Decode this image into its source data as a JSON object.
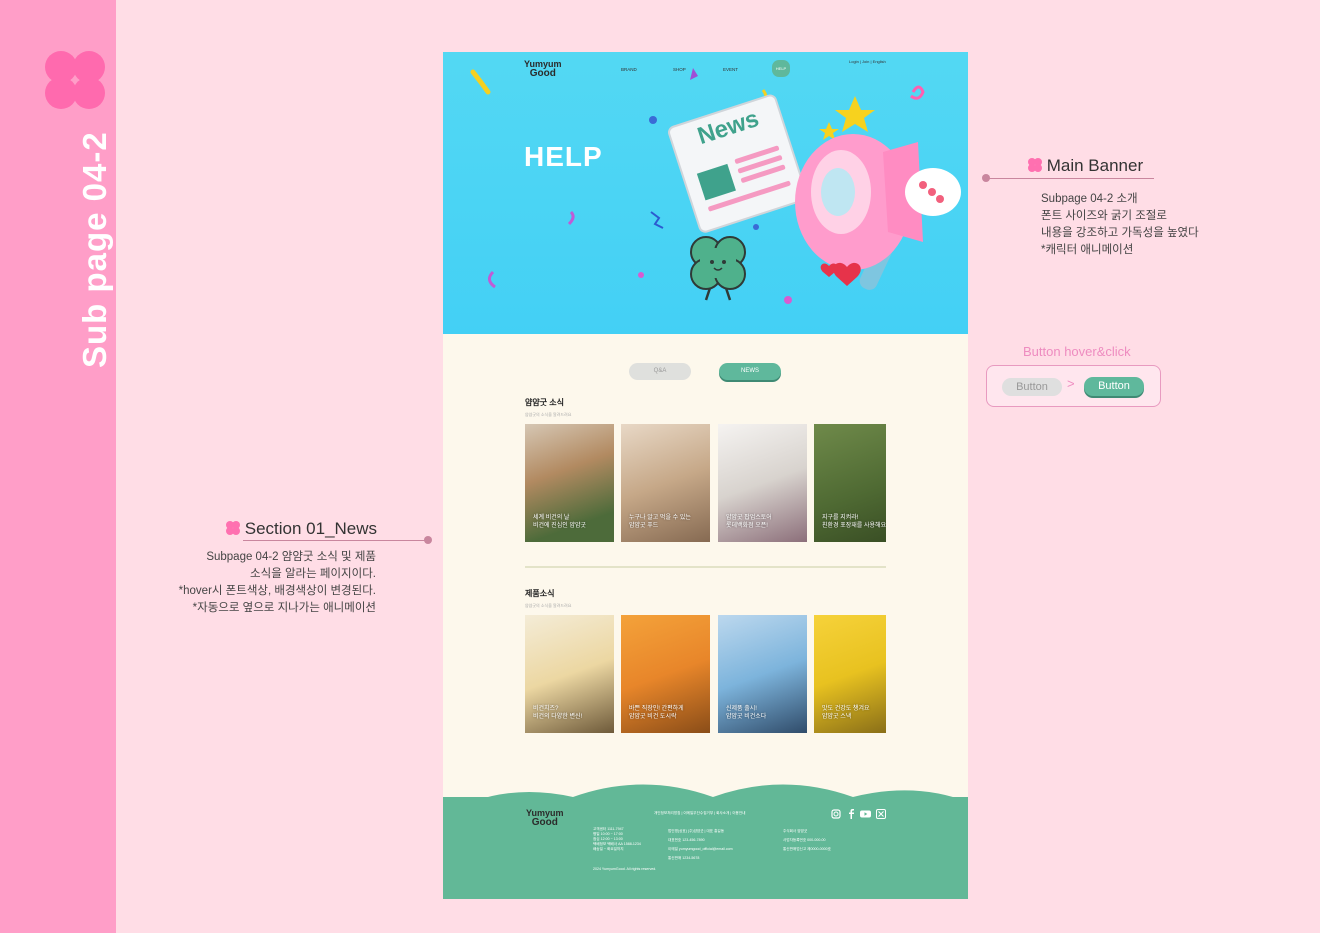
{
  "sidebar": {
    "title": "Sub page 04-2"
  },
  "annotations": {
    "main_banner": {
      "title": "Main Banner",
      "lines": [
        "Subpage 04-2 소개",
        "폰트 사이즈와 굵기 조절로",
        "내용을 강조하고 가독성을 높였다",
        "*캐릭터 애니메이션"
      ]
    },
    "section_news": {
      "title": "Section 01_News",
      "lines": [
        "Subpage 04-2 얌얌굿 소식 및 제품",
        "소식을 알라는 페이지이다.",
        "*hover시 폰트색상, 배경색상이 변경된다.",
        "*자동으로 옆으로 지나가는 애니메이션"
      ]
    },
    "button_demo": {
      "title": "Button hover&click",
      "normal": "Button",
      "arrow": ">",
      "active": "Button"
    }
  },
  "page": {
    "logo_line1": "Yumyum",
    "logo_line2": "Good",
    "nav": [
      "BRAND",
      "SHOP",
      "EVENT",
      "HELP"
    ],
    "nav_right": "Login | Join | English",
    "hero_title": "HELP",
    "hero_news_label": "News",
    "tabs": [
      "Q&A",
      "NEWS"
    ],
    "section1": {
      "title": "얌얌굿 소식",
      "subtitle": "얌얌굿의 소식을 알려드려요",
      "cards": [
        [
          "세계 비건의 날",
          "비건에 진심인 얌얌굿"
        ],
        [
          "누구나 알고 먹을 수 있는",
          "얌얌굿 푸드"
        ],
        [
          "얌얌굿 팝업스토어",
          "롯데백화점 오픈!"
        ],
        [
          "지구를 지켜라!",
          "친환경 포장재를 사용해요"
        ]
      ]
    },
    "section2": {
      "title": "제품소식",
      "subtitle": "얌얌굿의 소식을 알려드려요",
      "cards": [
        [
          "비건치즈?",
          "비건의 다양한 변신!"
        ],
        [
          "바쁜 직장인! 간편하게",
          "얌얌굿 비건 도시락"
        ],
        [
          "신제품 출시!",
          "얌얌굿 비건소다"
        ],
        [
          "맛도 건강도 챙겨요",
          "얌얌굿 스낵"
        ]
      ]
    },
    "footer": {
      "links": "개인정보처리방침 | 이메일무단수집거부 | 회사소개 | 이용안내",
      "col1": [
        "고객센터  1111-7947",
        "평일 10:00 ~ 17:00",
        "점심 12:00 ~ 13:00",
        "",
        "택배정보  택배사 AA 1588-1234",
        "배송일 ~ 화요일까지"
      ],
      "col2": [
        "법인명(상호)  (주)얌얌굿  |  대표 홍길동",
        "대표번호  123-456-7890",
        "이메일  yumyumgood_official@email.com",
        "통신판매  1234-5678"
      ],
      "col3": [
        "주식회사  얌얌굿",
        "사업자등록번호  000-000-00",
        "통신판매업신고  제0000-0000호"
      ],
      "copyright": "2024 YumyumGood. All rights reserved."
    }
  },
  "colors": {
    "accent_green": "#5fb89c",
    "accent_pink": "#ff9ec8",
    "hero_bg": "#4fd4f4"
  },
  "icons": [
    "clover-icon",
    "instagram-icon",
    "facebook-icon",
    "youtube-icon",
    "x-icon"
  ]
}
